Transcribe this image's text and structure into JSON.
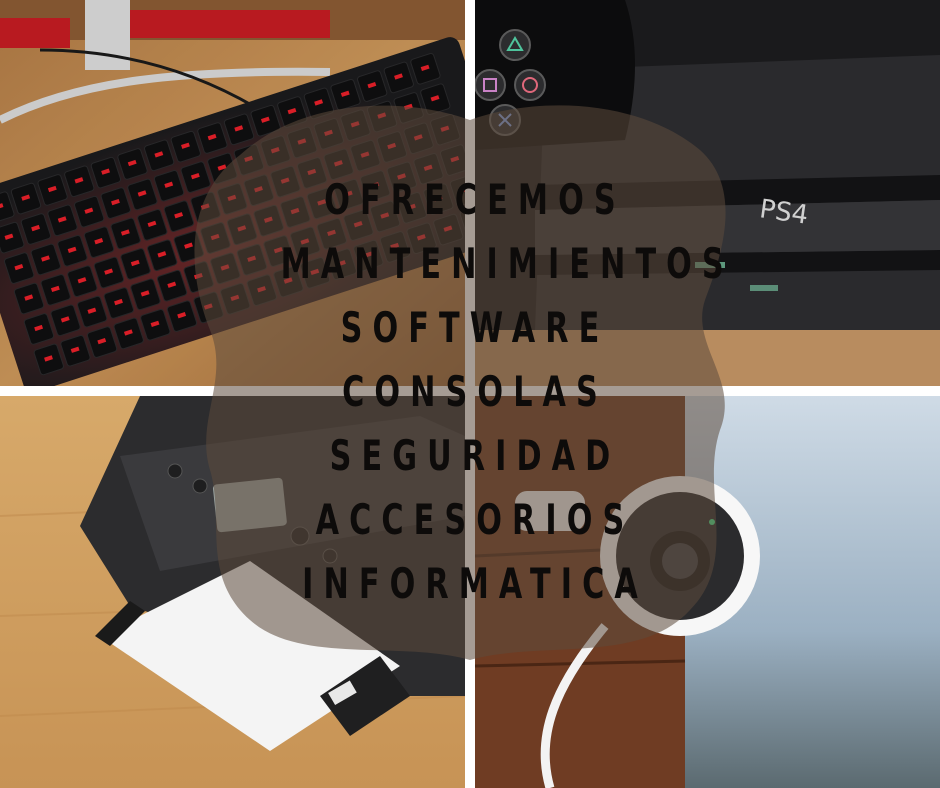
{
  "text_lines": [
    "OFRECEMOS",
    "MANTENIMIENTOS",
    "SOFTWARE",
    "CONSOLAS",
    "SEGURIDAD",
    "ACCESORIOS",
    "INFORMATICA"
  ],
  "photos": {
    "console_mark": "PS4"
  },
  "colors": {
    "text": "#0d0b0a",
    "overlay": "#5c4a3c",
    "key_glow": "#e5202a",
    "background": "#ffffff"
  }
}
